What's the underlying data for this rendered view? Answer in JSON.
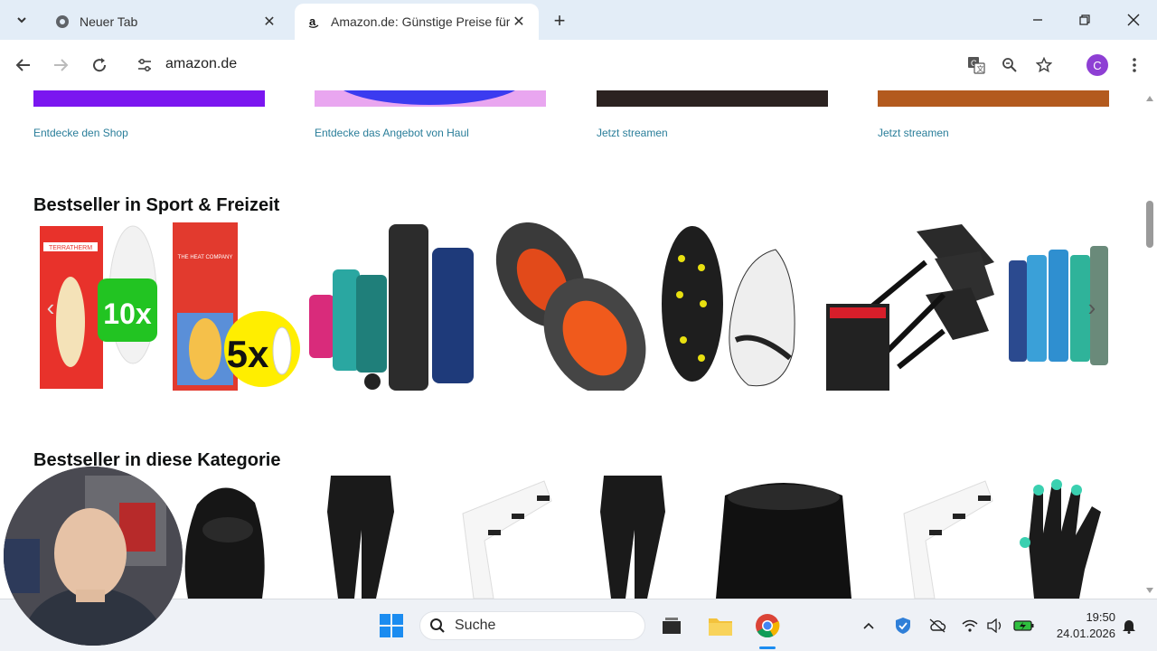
{
  "browser": {
    "tabs": [
      {
        "title": "Neuer Tab",
        "active": false
      },
      {
        "title": "Amazon.de: Günstige Preise für",
        "active": true
      }
    ],
    "url": "amazon.de",
    "profile_initial": "C"
  },
  "page": {
    "banners": [
      {
        "link": "Entdecke den Shop",
        "color": "#7b16f0"
      },
      {
        "link": "Entdecke das Angebot von Haul",
        "color": "#e9a6f0"
      },
      {
        "link": "Jetzt streamen",
        "color": "#2b2220"
      },
      {
        "link": "Jetzt streamen",
        "color": "#b35a1e"
      }
    ],
    "section1": {
      "title": "Bestseller in Sport & Freizeit",
      "products": [
        {
          "name": "insoles-10x",
          "badge": "10x",
          "brand": "TERRATHERM"
        },
        {
          "name": "heat-pads-5x",
          "badge": "5x",
          "brand": "THE HEAT COMPANY"
        },
        {
          "name": "water-bottles",
          "badge": "",
          "brand": ""
        },
        {
          "name": "hand-warmers",
          "badge": "",
          "brand": ""
        },
        {
          "name": "ice-cleats",
          "badge": "",
          "brand": ""
        },
        {
          "name": "dart-flights",
          "badge": "",
          "brand": ""
        },
        {
          "name": "bottle-set",
          "badge": "",
          "brand": ""
        }
      ]
    },
    "section2": {
      "title": "Bestseller in diese Kategorie"
    }
  },
  "taskbar": {
    "search_placeholder": "Suche",
    "time": "19:50",
    "date": "24.01.2026"
  },
  "colors": {
    "accent": "#2a7e9a",
    "tabstrip": "#e3edf7",
    "profile": "#8e3fd4"
  }
}
